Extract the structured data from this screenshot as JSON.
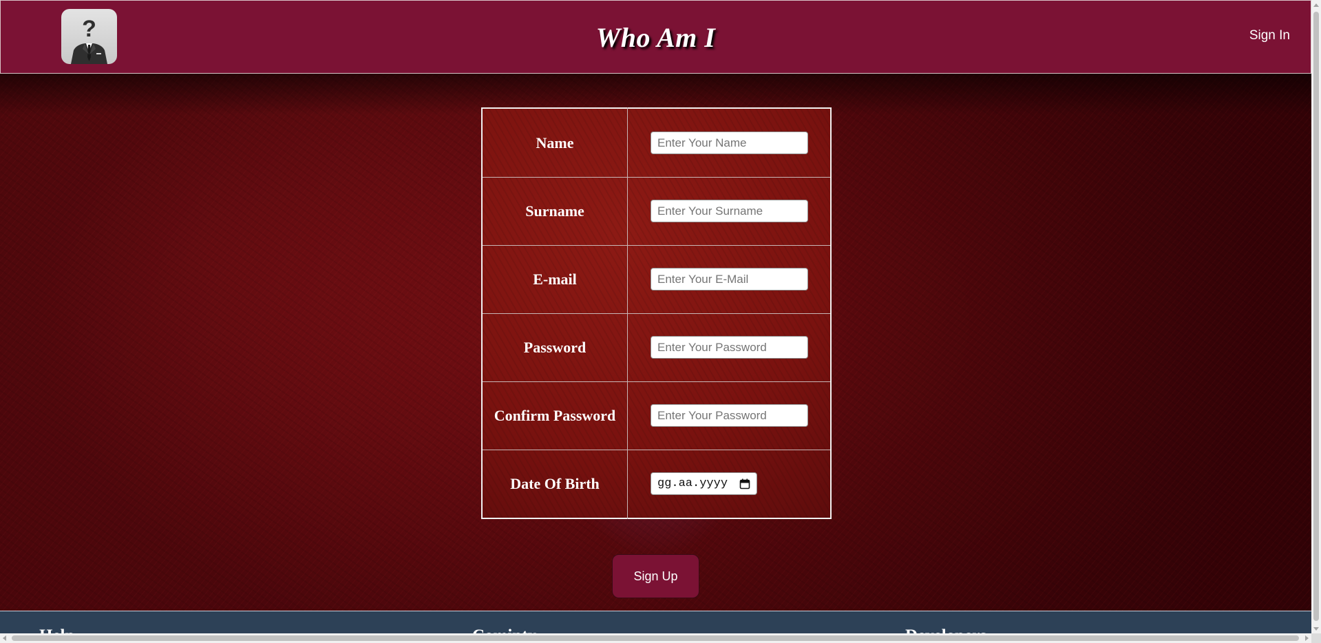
{
  "header": {
    "title": "Who Am I",
    "signin_label": "Sign In",
    "logo_icon": "anonymous-person-question-icon"
  },
  "form": {
    "rows": [
      {
        "label": "Name",
        "placeholder": "Enter Your Name",
        "input_type": "text"
      },
      {
        "label": "Surname",
        "placeholder": "Enter Your Surname",
        "input_type": "text"
      },
      {
        "label": "E-mail",
        "placeholder": "Enter Your E-Mail",
        "input_type": "text"
      },
      {
        "label": "Password",
        "placeholder": "Enter Your Password",
        "input_type": "password"
      },
      {
        "label": "Confirm Password",
        "placeholder": "Enter Your Password",
        "input_type": "password"
      },
      {
        "label": "Date Of Birth",
        "placeholder": "gg.aa.yyyy",
        "input_type": "date"
      }
    ],
    "submit_label": "Sign Up"
  },
  "footer": {
    "headings": [
      "Help",
      "Comipty",
      "Developers"
    ]
  },
  "colors": {
    "header_bg": "#7b1234",
    "button_bg": "#7b1234",
    "footer_bg": "#2d4157",
    "text": "#ffffff"
  }
}
